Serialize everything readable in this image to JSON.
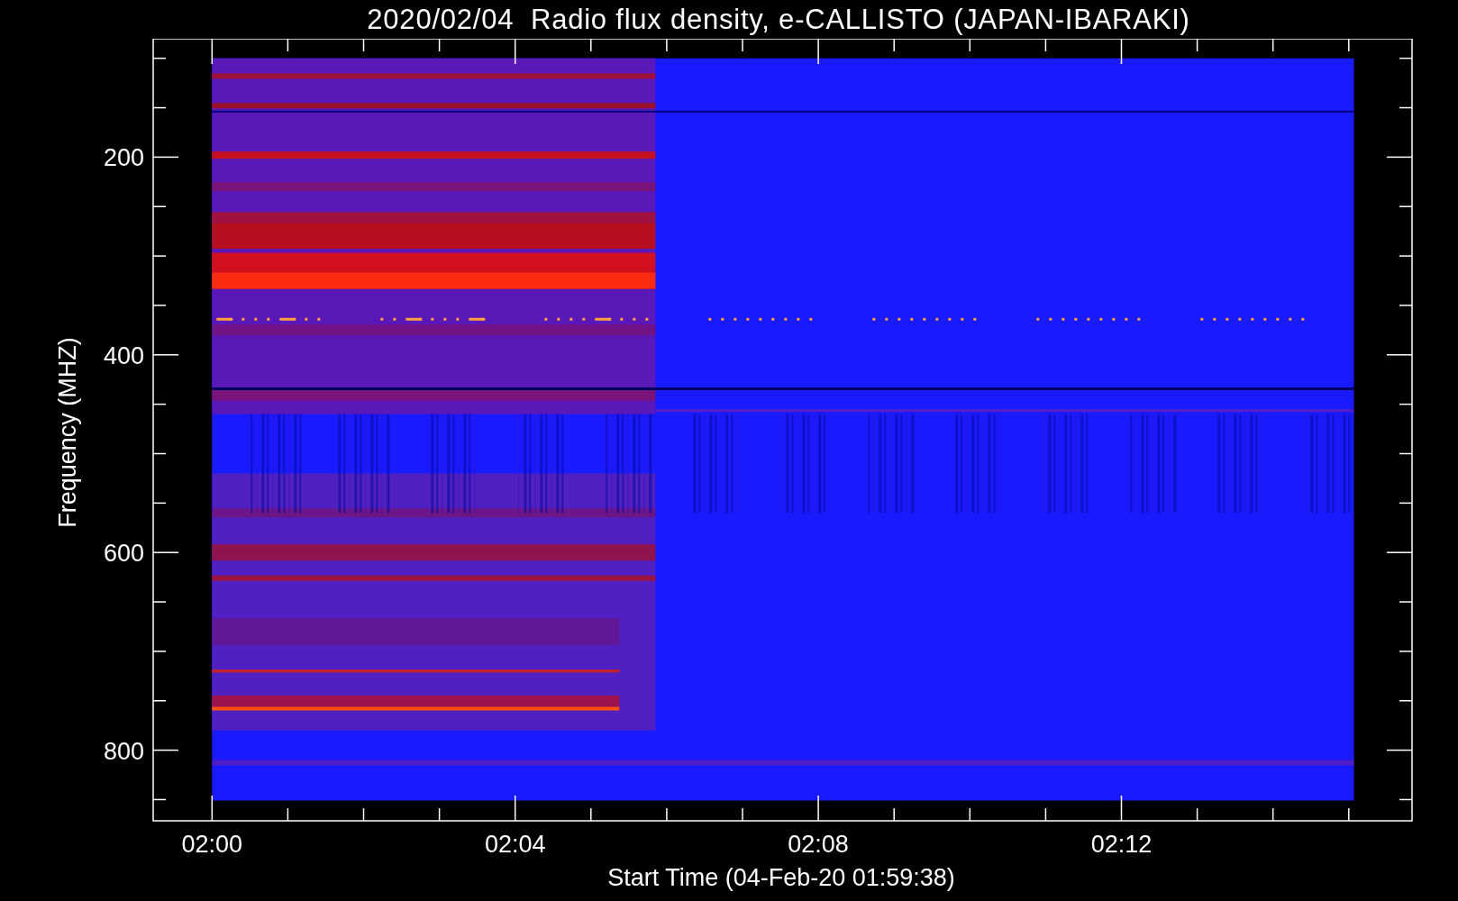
{
  "title": "2020/02/04  Radio flux density, e-CALLISTO (JAPAN-IBARAKI)",
  "y_axis": {
    "label": "Frequency (MHZ)",
    "tick_labels": [
      "200",
      "400",
      "600",
      "800"
    ]
  },
  "x_axis": {
    "label": "Start Time (04-Feb-20 01:59:38)",
    "tick_labels": [
      "02:00",
      "02:04",
      "02:08",
      "02:12"
    ]
  }
}
